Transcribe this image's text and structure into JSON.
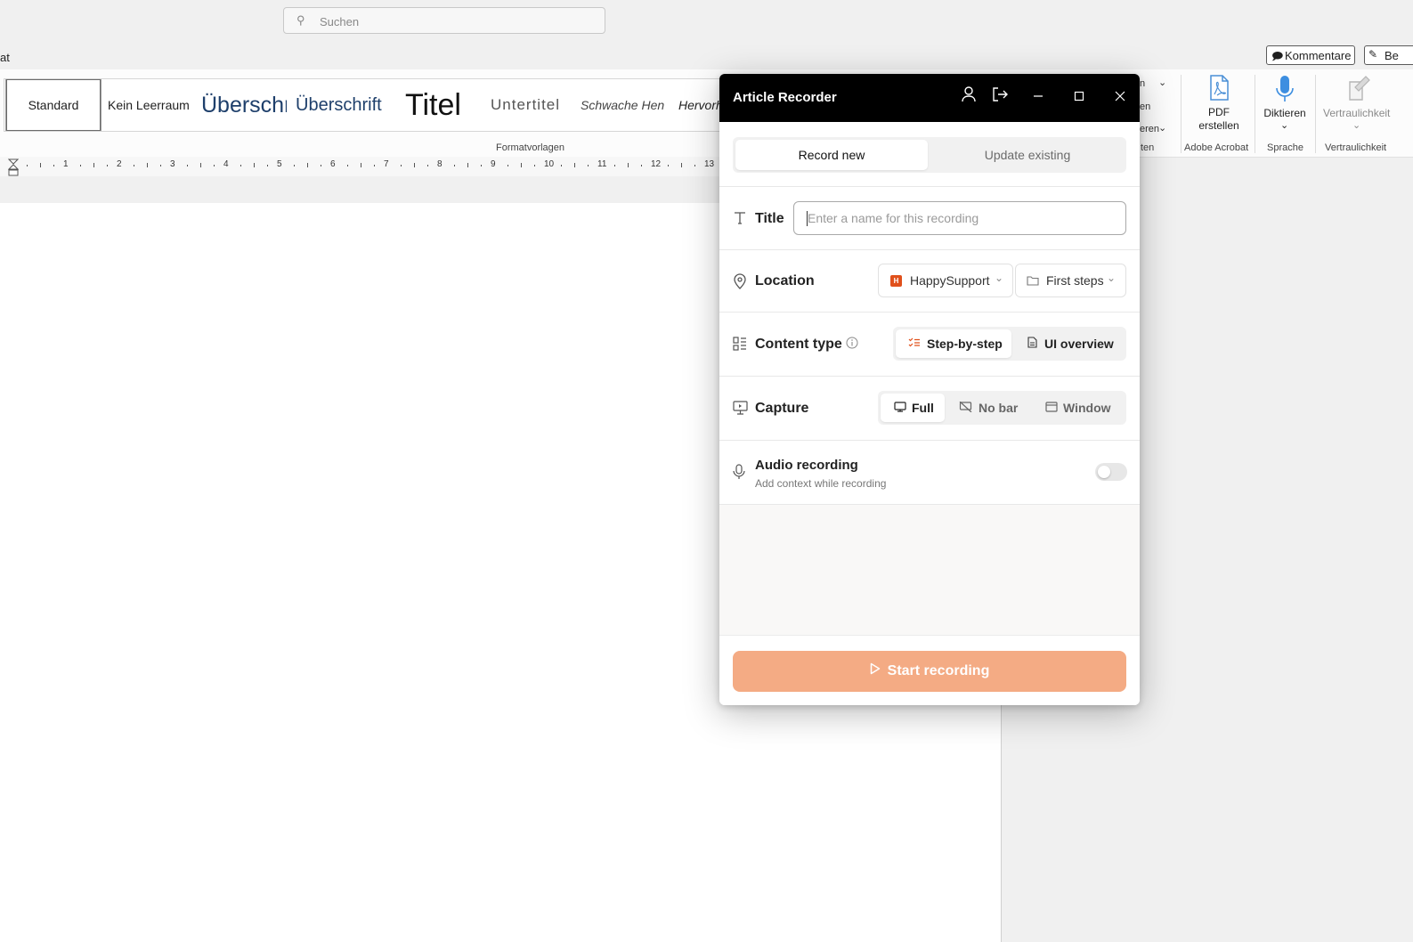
{
  "word": {
    "search_placeholder": "Suchen",
    "tab_cut": "at",
    "kommentare": "Kommentare",
    "bearbeiten_cut": "Be",
    "styles": [
      "Standard",
      "Kein Leerraum",
      "Überschr",
      "Überschrift",
      "Titel",
      "Untertitel",
      "Schwache Hen",
      "Hervorh"
    ],
    "styles_group": "Formatvorlagen",
    "partial_items": [
      "n",
      "en",
      "eren",
      "ten"
    ],
    "pdf_label_1": "PDF",
    "pdf_label_2": "erstellen",
    "acrobat_group": "Adobe Acrobat",
    "diktieren": "Diktieren",
    "sprache_group": "Sprache",
    "vertraulichkeit_btn": "Vertraulichkeit",
    "vertraulichkeit_group": "Vertraulichkeit",
    "ruler_numbers": [
      "1",
      "2",
      "3",
      "4",
      "5",
      "6",
      "7",
      "8",
      "9",
      "10",
      "11",
      "12",
      "13"
    ]
  },
  "recorder": {
    "title": "Article Recorder",
    "tabs": {
      "record_new": "Record new",
      "update_existing": "Update existing"
    },
    "title_row": {
      "label": "Title",
      "placeholder": "Enter a name for this recording"
    },
    "location": {
      "label": "Location",
      "workspace": "HappySupport",
      "workspace_badge": "H",
      "folder": "First steps"
    },
    "content_type": {
      "label": "Content type",
      "options": [
        "Step-by-step",
        "UI overview"
      ],
      "selected": "Step-by-step"
    },
    "capture": {
      "label": "Capture",
      "options": [
        "Full",
        "No bar",
        "Window"
      ],
      "selected": "Full"
    },
    "audio": {
      "label": "Audio recording",
      "sub": "Add context while recording",
      "enabled": false
    },
    "start_button": "Start recording",
    "accent_color": "#f4ab84",
    "icon_accent": "#e0501b"
  }
}
